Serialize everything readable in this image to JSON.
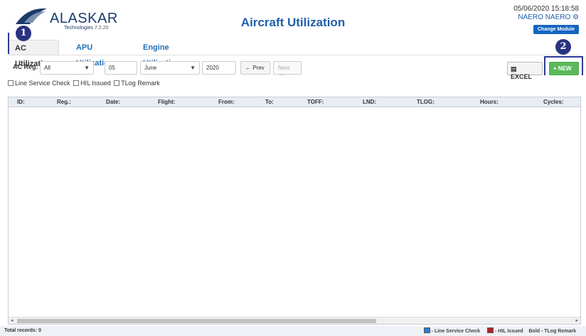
{
  "header": {
    "logo_text": "ALASKAR",
    "logo_sub": "Technologies",
    "version": "7.2.20",
    "title": "Aircraft Utilization",
    "datetime": "05/06/2020 15:18:58",
    "user": "NAERO NAERO",
    "change_module": "Change Module"
  },
  "tabs": [
    {
      "label": "AC Utilization",
      "active": true
    },
    {
      "label": "APU Utilization",
      "active": false
    },
    {
      "label": "Engine Utilization",
      "active": false
    }
  ],
  "annotations": {
    "badge1": "1",
    "badge2": "2"
  },
  "filters": {
    "ac_reg_label": "AC Reg:",
    "ac_reg_value": "All",
    "day_value": "05",
    "month_value": "June",
    "year_value": "2020",
    "prev_label": "← Prev",
    "next_label": "Next →",
    "excel_label": "EXCEL",
    "new_label": "+ NEW"
  },
  "checkboxes": [
    {
      "label": "Line Service Check",
      "checked": false
    },
    {
      "label": "HIL Issued",
      "checked": false
    },
    {
      "label": "TLog Remark",
      "checked": false
    }
  ],
  "table": {
    "columns": [
      "ID:",
      "Reg.:",
      "Date:",
      "Flight:",
      "From:",
      "To:",
      "TOFF:",
      "LND:",
      "TLOG:",
      "Hours:",
      "Cycles:"
    ],
    "rows": []
  },
  "footer": {
    "total_records": "Total records: 0",
    "legend": [
      {
        "label": "- Line Service Check",
        "color": "#2a7fd4"
      },
      {
        "label": "- HIL Issued",
        "color": "#b22222"
      },
      {
        "label": "Bold - TLog Remark",
        "color": null
      }
    ]
  },
  "colors": {
    "brand": "#1f5fa8",
    "new_button": "#5cb85c",
    "annotation": "#2a3380"
  }
}
